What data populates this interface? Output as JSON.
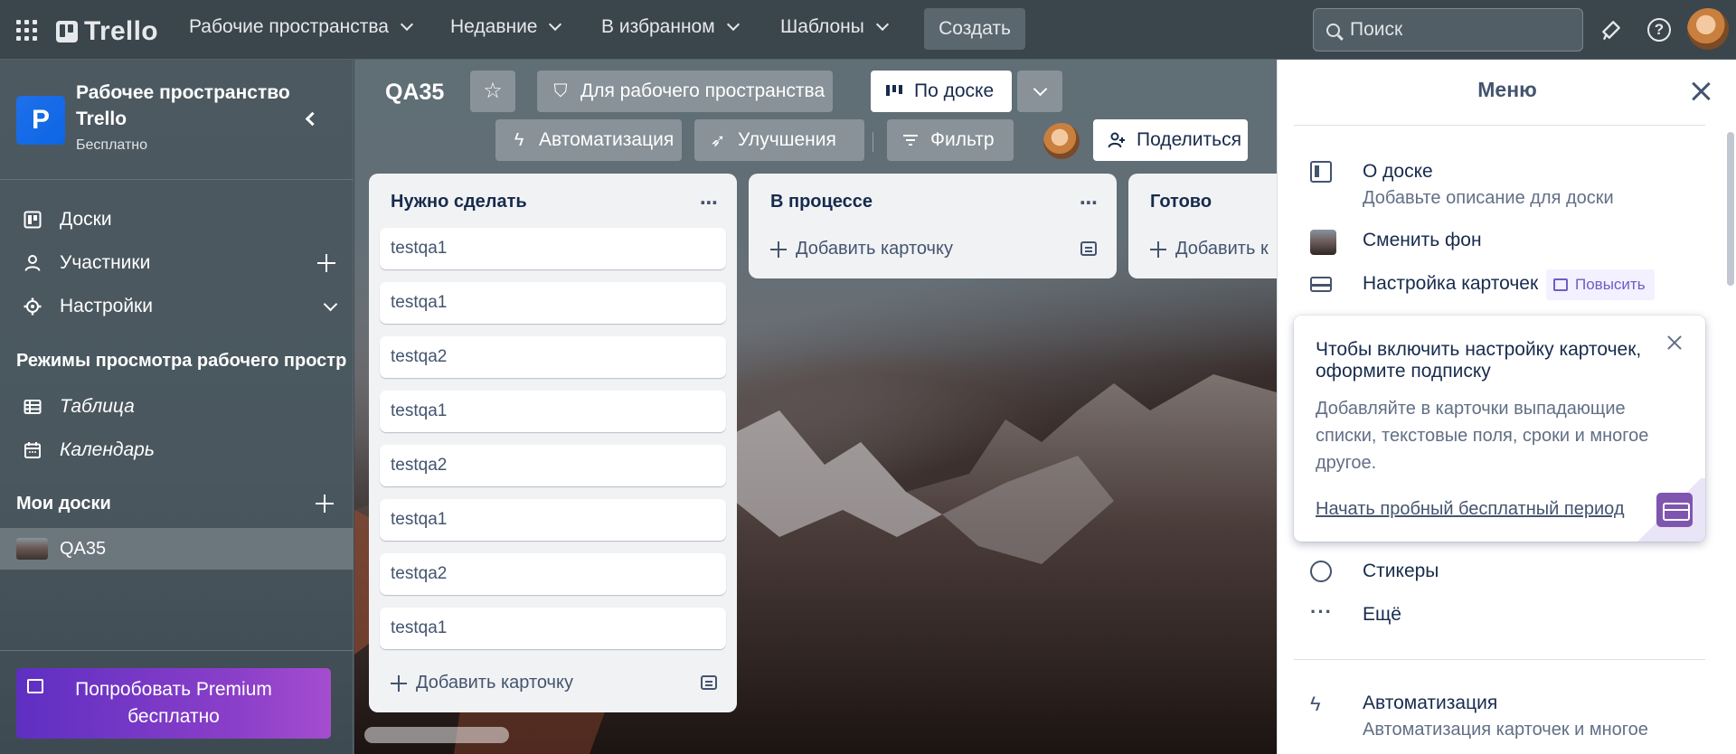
{
  "header": {
    "logo": "Trello",
    "nav": [
      {
        "label": "Рабочие пространства"
      },
      {
        "label": "Недавние"
      },
      {
        "label": "В избранном"
      },
      {
        "label": "Шаблоны"
      }
    ],
    "create_label": "Создать",
    "search_placeholder": "Поиск",
    "icons": [
      "apps-grid-icon",
      "notifications-icon",
      "help-icon",
      "avatar"
    ]
  },
  "sidebar": {
    "badge_letter": "P",
    "workspace_name": "Рабочее пространство Trello",
    "workspace_plan": "Бесплатно",
    "items": [
      {
        "label": "Доски",
        "icon": "board-icon"
      },
      {
        "label": "Участники",
        "icon": "person-icon"
      },
      {
        "label": "Настройки",
        "icon": "gear-icon"
      }
    ],
    "views_title": "Режимы просмотра рабочего пространства",
    "views": [
      {
        "label": "Таблица",
        "icon": "table-icon"
      },
      {
        "label": "Календарь",
        "icon": "calendar-icon"
      }
    ],
    "my_boards_title": "Мои доски",
    "boards": [
      {
        "label": "QA35"
      }
    ],
    "premium_label": "Попробовать Premium бесплатно"
  },
  "board": {
    "title": "QA35",
    "visibility_label": "Для рабочего пространства",
    "view_label": "По доске",
    "automation_label": "Автоматизация",
    "powerups_label": "Улучшения",
    "filter_label": "Фильтр",
    "share_label": "Поделиться",
    "lists": [
      {
        "title": "Нужно сделать",
        "cards": [
          "testqa1",
          "testqa1",
          "testqa2",
          "testqa1",
          "testqa2",
          "testqa1",
          "testqa2",
          "testqa1"
        ],
        "add_card_label": "Добавить карточку"
      },
      {
        "title": "В процессе",
        "cards": [],
        "add_card_label": "Добавить карточку"
      },
      {
        "title": "Готово",
        "cards": [],
        "add_card_label": "Добавить к"
      }
    ]
  },
  "menu": {
    "title": "Меню",
    "about": {
      "label": "О доске",
      "sub": "Добавьте описание для доски"
    },
    "change_bg": {
      "label": "Сменить фон"
    },
    "card_settings": {
      "label": "Настройка карточек",
      "badge": "Повысить"
    },
    "promo": {
      "title": "Чтобы включить настройку карточек, оформите подписку",
      "body": "Добавляйте в карточки выпадающие списки, текстовые поля, сроки и многое другое.",
      "link": "Начать пробный бесплатный период"
    },
    "stickers": {
      "label": "Стикеры"
    },
    "more": {
      "label": "Ещё"
    },
    "automation": {
      "label": "Автоматизация",
      "sub": "Автоматизация карточек и многое"
    }
  }
}
